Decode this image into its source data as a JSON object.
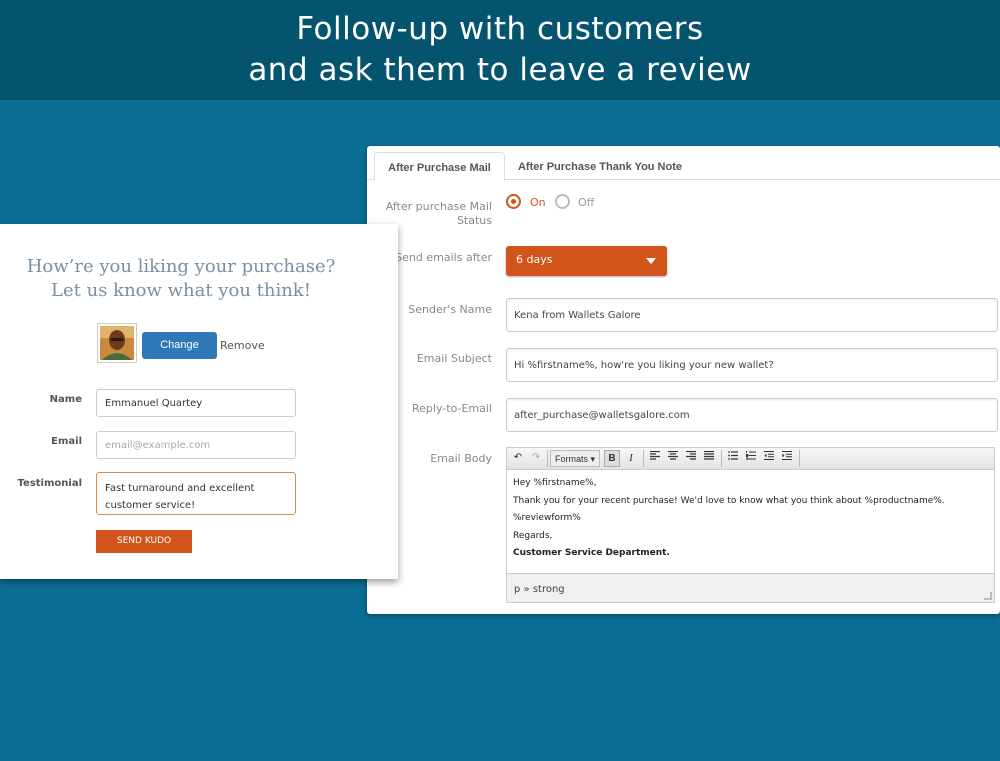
{
  "banner": {
    "line1": "Follow-up with customers",
    "line2": "and ask them to leave a review"
  },
  "settings": {
    "tabs": [
      {
        "label": "After Purchase Mail",
        "active": true
      },
      {
        "label": "After Purchase Thank You Note",
        "active": false
      }
    ],
    "status": {
      "label_line1": "After purchase Mail",
      "label_line2": "Status",
      "on_label": "On",
      "off_label": "Off",
      "selected": "On"
    },
    "send_after": {
      "label": "Send emails after",
      "value": "6 days"
    },
    "sender_name": {
      "label": "Sender's Name",
      "value": "Kena from Wallets Galore"
    },
    "email_subject": {
      "label": "Email Subject",
      "value": "Hi %firstname%, how're you liking your new wallet?"
    },
    "reply_to": {
      "label": "Reply-to-Email",
      "value": "after_purchase@walletsgalore.com"
    },
    "email_body": {
      "label": "Email Body",
      "toolbar": {
        "undo": "↶",
        "redo": "↷",
        "formats": "Formats",
        "bold": "B",
        "italic": "I"
      },
      "lines": [
        "Hey %firstname%,",
        "Thank you for your recent purchase! We'd love to know what you think about %productname%.",
        "%reviewform%",
        "Regards,",
        "Customer Service Department."
      ],
      "status_path": "p » strong"
    }
  },
  "kudo": {
    "heading_line1": "How’re you liking your purchase?",
    "heading_line2": "Let us know what you think!",
    "change_label": "Change",
    "remove_label": "Remove",
    "name_label": "Name",
    "name_value": "Emmanuel Quartey",
    "email_label": "Email",
    "email_placeholder": "email@example.com",
    "testimonial_label": "Testimonial",
    "testimonial_value": "Fast turnaround and excellent customer service!",
    "send_label": "SEND KUDO"
  },
  "colors": {
    "banner": "#04546f",
    "background": "#0b6f95",
    "accent": "#d1551b",
    "button_blue": "#2f79b9"
  }
}
